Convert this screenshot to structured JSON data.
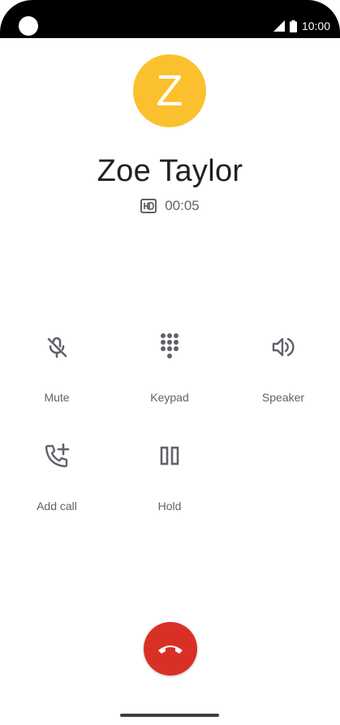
{
  "status_bar": {
    "time": "10:00"
  },
  "contact": {
    "initial": "Z",
    "name": "Zoe Taylor",
    "avatar_color": "#fbc02d"
  },
  "call": {
    "quality_badge": "HD",
    "duration": "00:05"
  },
  "controls": {
    "mute": {
      "label": "Mute",
      "icon": "mic-off-icon"
    },
    "keypad": {
      "label": "Keypad",
      "icon": "dialpad-icon"
    },
    "speaker": {
      "label": "Speaker",
      "icon": "volume-icon"
    },
    "add_call": {
      "label": "Add call",
      "icon": "add-call-icon"
    },
    "hold": {
      "label": "Hold",
      "icon": "pause-icon"
    }
  },
  "end_call": {
    "icon": "call-end-icon",
    "color": "#d93025"
  }
}
